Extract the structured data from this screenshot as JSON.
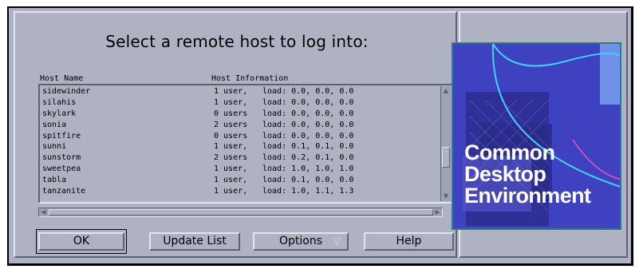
{
  "dialog": {
    "title": "Select a remote host to log into:",
    "columns": {
      "host_name": "Host Name",
      "host_info": "Host Information"
    }
  },
  "hosts": [
    {
      "name": "sidewinder",
      "users": "1 user,",
      "load": "load: 0.0, 0.0, 0.0"
    },
    {
      "name": "silahis",
      "users": "1 user,",
      "load": "load: 0.0, 0.0, 0.0"
    },
    {
      "name": "skylark",
      "users": "0 users",
      "load": "load: 0.0, 0.0, 0.0"
    },
    {
      "name": "sonia",
      "users": "2 users",
      "load": "load: 0.0, 0.0, 0.0"
    },
    {
      "name": "spitfire",
      "users": "0 users",
      "load": "load: 0.0, 0.0, 0.0"
    },
    {
      "name": "sunni",
      "users": "1 user,",
      "load": "load: 0.1, 0.1, 0.0"
    },
    {
      "name": "sunstorm",
      "users": "2 users",
      "load": "load: 0.2, 0.1, 0.0"
    },
    {
      "name": "sweetpea",
      "users": "1 user,",
      "load": "load: 1.0, 1.0, 1.0"
    },
    {
      "name": "tabla",
      "users": "1 user,",
      "load": "load: 0.1, 0.0, 0.0"
    },
    {
      "name": "tanzanite",
      "users": "1 user,",
      "load": "load: 1.0, 1.1, 1.3"
    }
  ],
  "buttons": {
    "ok": "OK",
    "update_list": "Update List",
    "options": "Options",
    "help": "Help"
  },
  "logo": {
    "line1": "Common",
    "line2": "Desktop",
    "line3": "Environment"
  },
  "icons": {
    "scroll_up": "scroll-up-icon",
    "scroll_down": "scroll-down-icon",
    "scroll_left": "scroll-left-icon",
    "scroll_right": "scroll-right-icon",
    "options_menu": "triangle-down-icon"
  },
  "colors": {
    "background": "#aeb2c3",
    "logo_bg": "#3e41c0"
  }
}
